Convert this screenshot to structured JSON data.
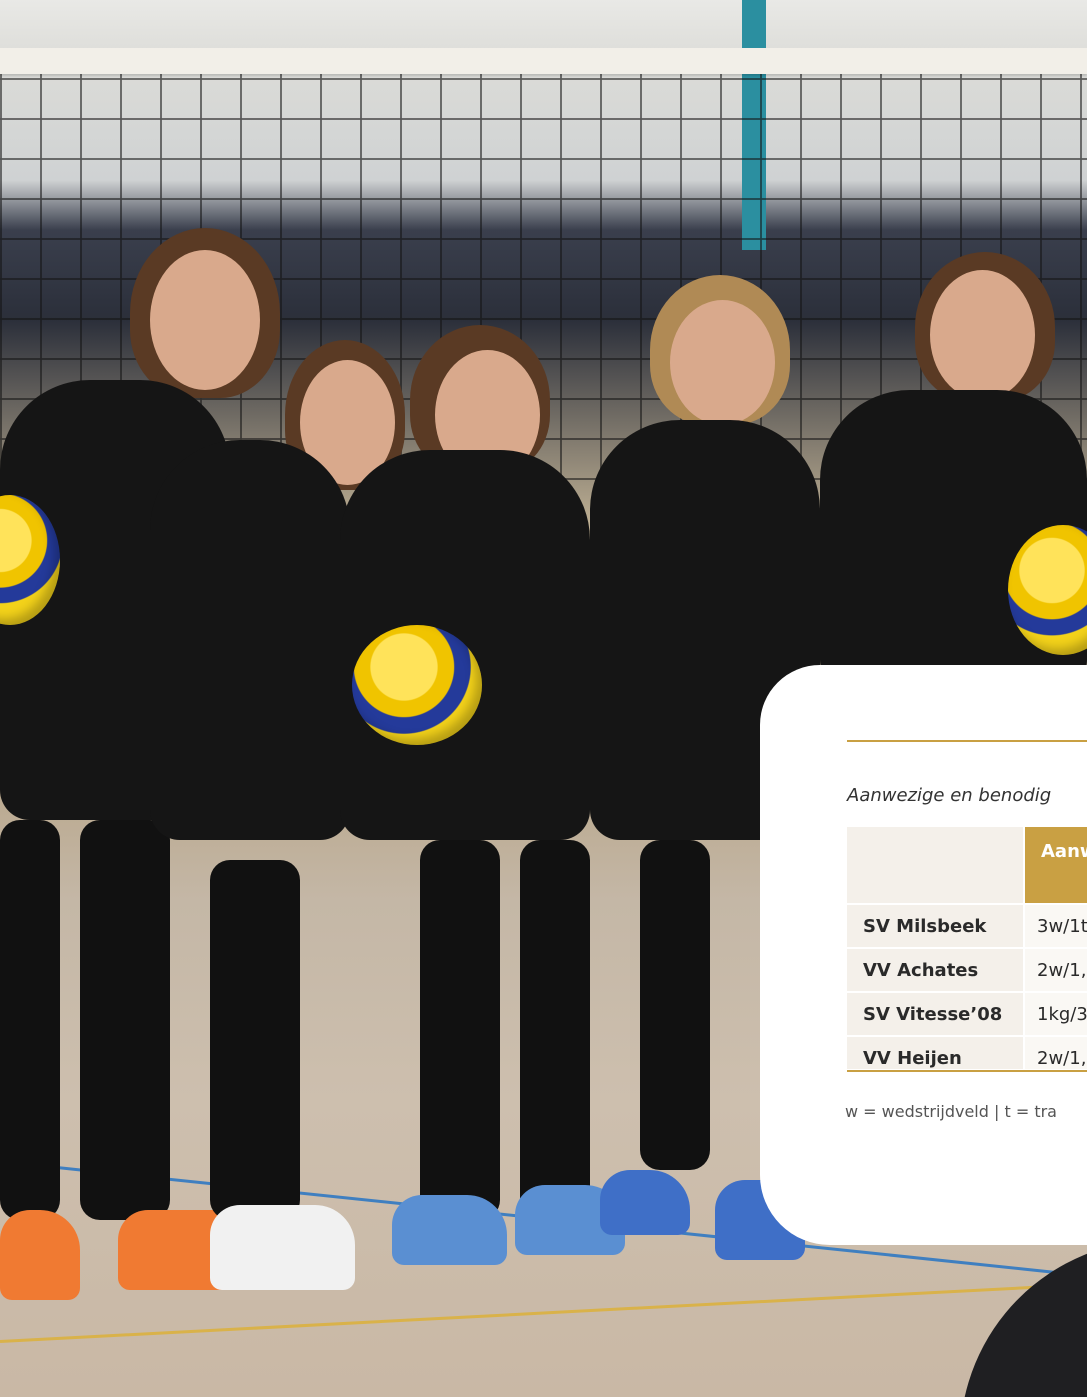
{
  "photo": {
    "description_icon": "team-photo",
    "accent": "#c9a043"
  },
  "card": {
    "caption": "Aanwezige en benodig",
    "header_label": "Aanw",
    "rows": [
      {
        "club": "SV Milsbeek",
        "value": "3w/1t"
      },
      {
        "club": "VV Achates",
        "value": "2w/1,"
      },
      {
        "club": "SV Vitesse’08",
        "value": "1kg/3"
      },
      {
        "club": "VV Heijen",
        "value": "2w/1,"
      }
    ],
    "legend": "w = wedstrijdveld | t = tra"
  }
}
